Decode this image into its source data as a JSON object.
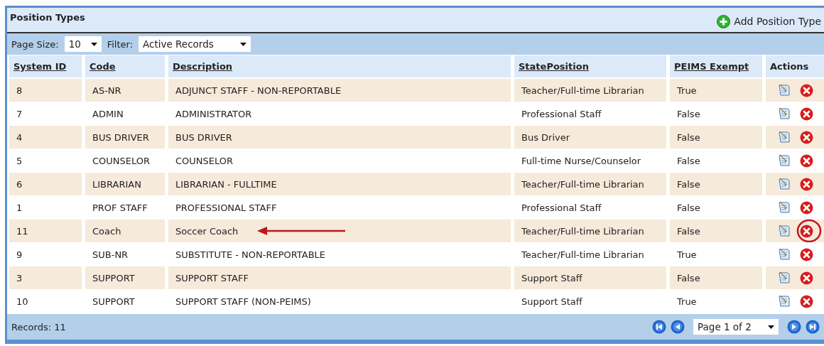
{
  "panel": {
    "title": "Position Types",
    "add_button": "Add Position Type"
  },
  "toolbar": {
    "page_size_label": "Page Size:",
    "page_size": "10",
    "filter_label": "Filter:",
    "filter": "Active Records"
  },
  "table": {
    "columns": [
      {
        "label": "System ID",
        "sortable": true
      },
      {
        "label": "Code",
        "sortable": true
      },
      {
        "label": "Description",
        "sortable": true
      },
      {
        "label": "StatePosition",
        "sortable": true
      },
      {
        "label": "PEIMS Exempt",
        "sortable": true
      },
      {
        "label": "Actions",
        "sortable": false
      }
    ],
    "rows": [
      {
        "id": "8",
        "code": "AS-NR",
        "description": "ADJUNCT STAFF - NON-REPORTABLE",
        "state_position": "Teacher/Full-time Librarian",
        "peims_exempt": "True",
        "annotated": false
      },
      {
        "id": "7",
        "code": "ADMIN",
        "description": "ADMINISTRATOR",
        "state_position": "Professional Staff",
        "peims_exempt": "False",
        "annotated": false
      },
      {
        "id": "4",
        "code": "BUS DRIVER",
        "description": "BUS DRIVER",
        "state_position": "Bus Driver",
        "peims_exempt": "False",
        "annotated": false
      },
      {
        "id": "5",
        "code": "COUNSELOR",
        "description": "COUNSELOR",
        "state_position": "Full-time Nurse/Counselor",
        "peims_exempt": "False",
        "annotated": false
      },
      {
        "id": "6",
        "code": "LIBRARIAN",
        "description": "LIBRARIAN - FULLTIME",
        "state_position": "Teacher/Full-time Librarian",
        "peims_exempt": "False",
        "annotated": false
      },
      {
        "id": "1",
        "code": "PROF STAFF",
        "description": "PROFESSIONAL STAFF",
        "state_position": "Professional Staff",
        "peims_exempt": "False",
        "annotated": false
      },
      {
        "id": "11",
        "code": "Coach",
        "description": "Soccer Coach",
        "state_position": "Teacher/Full-time Librarian",
        "peims_exempt": "False",
        "annotated": true
      },
      {
        "id": "9",
        "code": "SUB-NR",
        "description": "SUBSTITUTE - NON-REPORTABLE",
        "state_position": "Teacher/Full-time Librarian",
        "peims_exempt": "True",
        "annotated": false
      },
      {
        "id": "3",
        "code": "SUPPORT",
        "description": "SUPPORT STAFF",
        "state_position": "Support Staff",
        "peims_exempt": "False",
        "annotated": false
      },
      {
        "id": "10",
        "code": "SUPPORT",
        "description": "SUPPORT STAFF (NON-PEIMS)",
        "state_position": "Support Staff",
        "peims_exempt": "True",
        "annotated": false
      }
    ]
  },
  "footer": {
    "records": "Records: 11",
    "page": "Page 1 of 2"
  }
}
